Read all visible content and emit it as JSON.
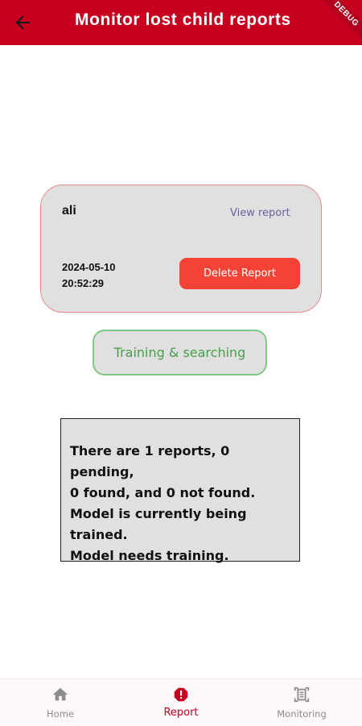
{
  "app_bar": {
    "title": "Monitor lost child reports",
    "debug_banner": "DEBUG",
    "background": "#c8001f"
  },
  "report": {
    "name": "ali",
    "view_label": "View report",
    "date": "2024-05-10",
    "time": "20:52:29",
    "delete_label": "Delete Report"
  },
  "training_button": {
    "label": "Training & searching"
  },
  "status": {
    "lines": [
      "There are 1 reports, 0 pending,",
      "0 found, and 0 not found.",
      "Model is currently being",
      "trained.",
      "Model needs training."
    ]
  },
  "bottom_nav": {
    "items": [
      {
        "label": "Home",
        "icon": "home-icon",
        "active": false
      },
      {
        "label": "Report",
        "icon": "alert-octagon-icon",
        "active": true
      },
      {
        "label": "Monitoring",
        "icon": "document-scanner-icon",
        "active": false
      }
    ]
  }
}
